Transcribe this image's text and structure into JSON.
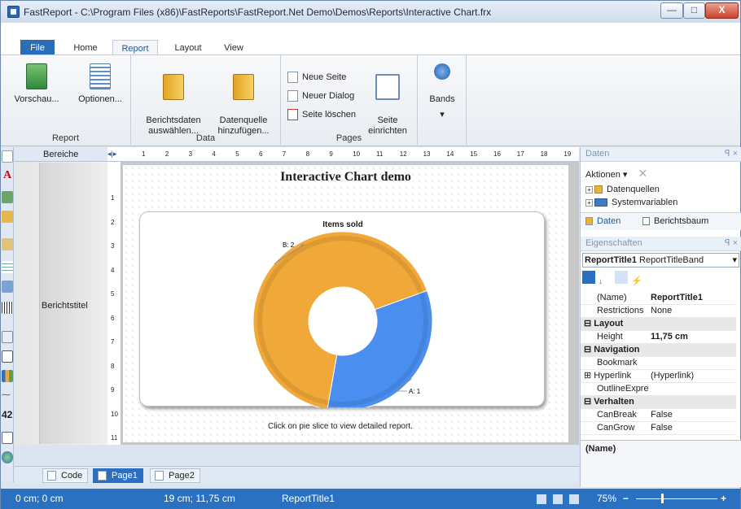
{
  "window": {
    "title": "FastReport - C:\\Program Files (x86)\\FastReports\\FastReport.Net Demo\\Demos\\Reports\\Interactive Chart.frx",
    "minimize": "—",
    "maximize": "□",
    "close": "X"
  },
  "tabs": {
    "file": "File",
    "home": "Home",
    "report": "Report",
    "layout": "Layout",
    "view": "View"
  },
  "ribbon": {
    "report_group": {
      "label": "Report",
      "preview": "Vorschau...",
      "options": "Optionen..."
    },
    "data_group": {
      "label": "Data",
      "select": "Berichtsdaten\nauswählen...",
      "add": "Datenquelle\nhinzufügen..."
    },
    "pages_group": {
      "label": "Pages",
      "new_page": "Neue Seite",
      "new_dialog": "Neuer Dialog",
      "delete_page": "Seite löschen",
      "page_setup": "Seite\neinrichten"
    },
    "bands_group": {
      "label": "Bands",
      "dropdown": "▾"
    }
  },
  "bands": {
    "header": "Bereiche",
    "title_band": "Berichtstitel"
  },
  "ruler": {
    "marks": [
      "1",
      "2",
      "3",
      "4",
      "5",
      "6",
      "7",
      "8",
      "9",
      "10",
      "11",
      "12",
      "13",
      "14",
      "15",
      "16",
      "17",
      "18",
      "19"
    ]
  },
  "vruler": {
    "marks": [
      "1",
      "2",
      "3",
      "4",
      "5",
      "6",
      "7",
      "8",
      "9",
      "10",
      "11"
    ]
  },
  "report": {
    "title": "Interactive Chart demo",
    "hint": "Click on pie slice to view detailed report."
  },
  "chart_data": {
    "type": "pie",
    "title": "Items sold",
    "categories": [
      "A",
      "B"
    ],
    "values": [
      1,
      2
    ],
    "labels": [
      "A: 1",
      "B: 2"
    ],
    "colors": [
      "#4a8ff0",
      "#f0a838"
    ],
    "donut": true
  },
  "pages": {
    "code": "Code",
    "page1": "Page1",
    "page2": "Page2"
  },
  "status": {
    "position": "0 cm; 0 cm",
    "size": "19 cm; 11,75 cm",
    "object": "ReportTitle1",
    "zoom": "75%",
    "minus": "−",
    "plus": "+"
  },
  "data_panel": {
    "title": "Daten",
    "actions": "Aktionen",
    "tree": [
      "Datenquellen",
      "Systemvariablen"
    ],
    "tab_data": "Daten",
    "tab_tree": "Berichtsbaum",
    "pin": "ꟼ ×"
  },
  "props_panel": {
    "title": "Eigenschaften",
    "object": "ReportTitle1",
    "type": "ReportTitleBand",
    "rows": [
      {
        "k": "(Name)",
        "v": "ReportTitle1",
        "bold": true
      },
      {
        "k": "Restrictions",
        "v": "None"
      },
      {
        "k": "Layout",
        "cat": true
      },
      {
        "k": "Height",
        "v": "11,75 cm",
        "bold": true
      },
      {
        "k": "Navigation",
        "cat": true
      },
      {
        "k": "Bookmark",
        "v": ""
      },
      {
        "k": "Hyperlink",
        "v": "(Hyperlink)",
        "expand": true
      },
      {
        "k": "OutlineExpre",
        "v": ""
      },
      {
        "k": "Verhalten",
        "cat": true
      },
      {
        "k": "CanBreak",
        "v": "False"
      },
      {
        "k": "CanGrow",
        "v": "False"
      }
    ],
    "desc": "(Name)"
  }
}
